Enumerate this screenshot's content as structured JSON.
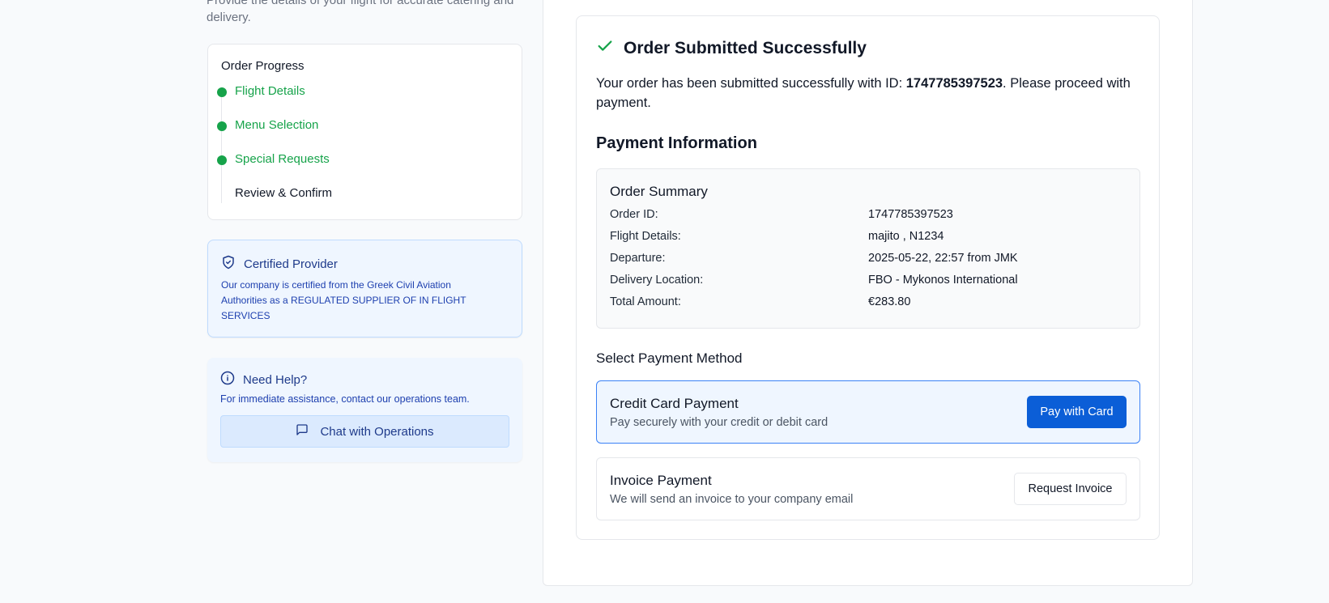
{
  "intro_text": "Provide the details of your flight for accurate catering and delivery.",
  "progress": {
    "title": "Order Progress",
    "steps": [
      {
        "label": "Flight Details",
        "status": "done"
      },
      {
        "label": "Menu Selection",
        "status": "done"
      },
      {
        "label": "Special Requests",
        "status": "done"
      },
      {
        "label": "Review & Confirm",
        "status": "current"
      }
    ]
  },
  "certified": {
    "icon": "shield-check-icon",
    "title": "Certified Provider",
    "text": "Our company is certified from the Greek Civil Aviation Authorities as a REGULATED SUPPLIER OF IN FLIGHT SERVICES"
  },
  "help": {
    "icon": "info-icon",
    "title": "Need Help?",
    "text": "For immediate assistance, contact our operations team.",
    "chat_icon": "message-square-icon",
    "chat_label": "Chat with Operations"
  },
  "success": {
    "icon": "check-icon",
    "title": "Order Submitted Successfully",
    "message_prefix": "Your order has been submitted successfully with ID: ",
    "order_id": "1747785397523",
    "message_suffix": ". Please proceed with payment."
  },
  "payment": {
    "title": "Payment Information",
    "summary_title": "Order Summary",
    "summary": [
      {
        "key": "Order ID:",
        "value": "1747785397523"
      },
      {
        "key": "Flight Details:",
        "value": "majito , N1234"
      },
      {
        "key": "Departure:",
        "value": "2025-05-22, 22:57 from JMK"
      },
      {
        "key": "Delivery Location:",
        "value": "FBO - Mykonos International"
      },
      {
        "key": "Total Amount:",
        "value": "€283.80"
      }
    ],
    "method_title": "Select Payment Method",
    "methods": [
      {
        "name": "Credit Card Payment",
        "desc": "Pay securely with your credit or debit card",
        "button": "Pay with Card"
      },
      {
        "name": "Invoice Payment",
        "desc": "We will send an invoice to your company email",
        "button": "Request Invoice"
      }
    ]
  },
  "colors": {
    "success_green": "#16a34a",
    "primary_blue": "#0b5ed7",
    "info_bg": "#eff6ff"
  }
}
